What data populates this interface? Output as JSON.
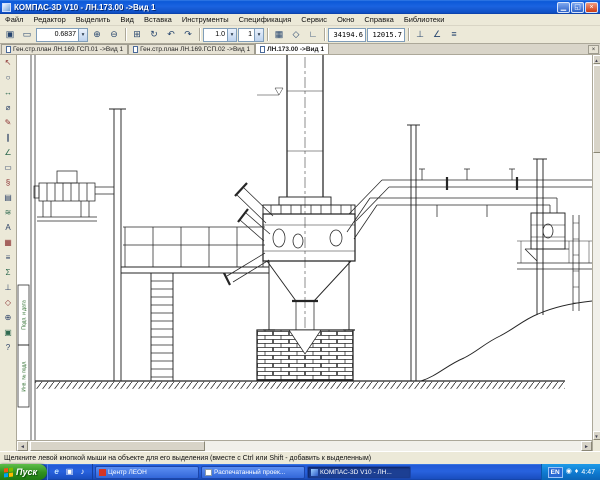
{
  "window": {
    "title": "КОМПАС-3D V10 - ЛН.173.00 ->Вид 1",
    "minimize": "▁",
    "maximize": "◱",
    "close": "×"
  },
  "menu": {
    "items": [
      "Файл",
      "Редактор",
      "Выделить",
      "Вид",
      "Вставка",
      "Инструменты",
      "Спецификация",
      "Сервис",
      "Окно",
      "Справка",
      "Библиотеки"
    ]
  },
  "toolbar": {
    "zoom_value": "0.6837",
    "step_value": "1.0",
    "layer_value": "1",
    "coord_x": "34194.6",
    "coord_y": "12015.7",
    "icons": {
      "zoom_page": "▣",
      "zoom_frame": "▭",
      "zoom_in": "⊕",
      "zoom_out": "⊖",
      "pan": "⊞",
      "refresh": "↻",
      "prev_view": "↶",
      "next_view": "↷",
      "grid": "▦",
      "snap": "◇",
      "ortho": "∟",
      "perp": "⊥",
      "angle": "∠",
      "settings": "≡"
    }
  },
  "ui": {
    "dropdown_arrow": "▾",
    "scroll_up": "▲",
    "scroll_down": "▼",
    "scroll_left": "◄",
    "scroll_right": "►"
  },
  "tabs": [
    {
      "label": "Ген.стр.план ЛН.169.ГСП.01 ->Вид 1"
    },
    {
      "label": "Ген.стр.план ЛН.169.ГСП.02 ->Вид 1"
    },
    {
      "label": "ЛН.173.00 ->Вид 1"
    }
  ],
  "leftpanel": {
    "icons": [
      "↖",
      "○",
      "↔",
      "⌀",
      "✎",
      "∥",
      "∠",
      "▭",
      "§",
      "▤",
      "≋",
      "А",
      "▦",
      "≡",
      "Σ",
      "⊥",
      "◇",
      "⊕",
      "▣",
      "?"
    ]
  },
  "margin": {
    "label_top": "Подп. и дата",
    "label_bottom": "Инв. № подл."
  },
  "status": {
    "hint": "Щелкните левой кнопкой мыши на объекте для его выделения (вместе с Ctrl или Shift - добавить к выделенным)"
  },
  "taskbar": {
    "start_label": "Пуск",
    "quick": [
      "e",
      "▣",
      "♪"
    ],
    "tasks": [
      "Центр ЛЕОН",
      "Распечатанный проек...",
      "КОМПАС-3D V10 - ЛН..."
    ],
    "tray_icons": [
      "◉",
      "♦"
    ],
    "tray_lang": "EN",
    "tray_time": "4:47"
  }
}
